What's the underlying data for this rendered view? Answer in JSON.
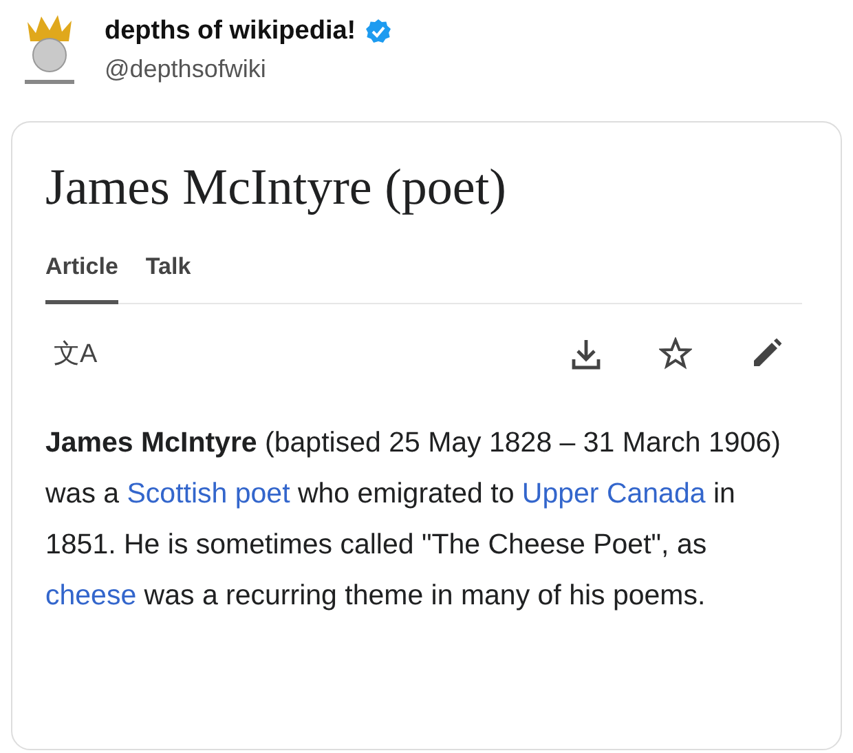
{
  "tweet": {
    "display_name": "depths of wikipedia!",
    "verified": true,
    "handle": "@depthsofwiki"
  },
  "article": {
    "title": "James McIntyre (poet)",
    "tabs": [
      {
        "label": "Article",
        "selected": true
      },
      {
        "label": "Talk",
        "selected": false
      }
    ],
    "language_glyph": "文A",
    "intro": [
      {
        "kind": "bold",
        "text": "James McIntyre"
      },
      {
        "kind": "plain",
        "text": " (baptised 25 May 1828 – 31 March 1906) was a "
      },
      {
        "kind": "link",
        "text": "Scottish poet"
      },
      {
        "kind": "plain",
        "text": " who emigrated to "
      },
      {
        "kind": "link",
        "text": "Upper Canada"
      },
      {
        "kind": "plain",
        "text": " in 1851. He is sometimes called \"The Cheese Poet\", as "
      },
      {
        "kind": "link",
        "text": "cheese"
      },
      {
        "kind": "plain",
        "text": " was a recurring theme in many of his poems."
      }
    ]
  }
}
